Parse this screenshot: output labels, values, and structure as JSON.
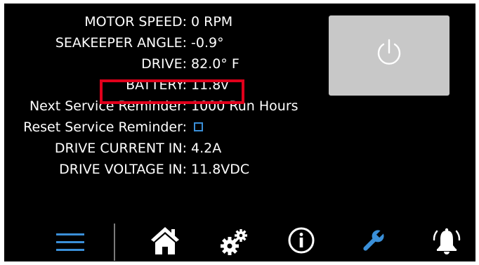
{
  "readouts": [
    {
      "label": "MOTOR SPEED:",
      "value": "0 RPM"
    },
    {
      "label": "SEAKEEPER ANGLE:",
      "value": "-0.9°"
    },
    {
      "label": "DRIVE:",
      "value": "82.0° F"
    },
    {
      "label": "BATTERY:",
      "value": "11.8v"
    },
    {
      "label": "Next Service Reminder:",
      "value": "1000 Run Hours"
    },
    {
      "label": "Reset Service Reminder:",
      "value": ""
    },
    {
      "label": "DRIVE CURRENT IN:",
      "value": "4.2A"
    },
    {
      "label": "DRIVE VOLTAGE IN:",
      "value": "11.8VDC"
    }
  ],
  "reset_checkbox_checked": false,
  "nav": {
    "items": [
      {
        "icon": "menu-icon",
        "color": "#3a8fd8"
      },
      {
        "icon": "home-icon",
        "color": "#ffffff"
      },
      {
        "icon": "gears-icon",
        "color": "#ffffff"
      },
      {
        "icon": "info-icon",
        "color": "#ffffff"
      },
      {
        "icon": "wrench-icon",
        "color": "#3a8fd8",
        "active": true
      },
      {
        "icon": "alarm-bell-icon",
        "color": "#ffffff"
      }
    ]
  },
  "colors": {
    "background": "#000000",
    "text": "#ffffff",
    "accent": "#3a8fd8",
    "highlight": "#e0001b",
    "power_button": "#c8c8c8"
  }
}
